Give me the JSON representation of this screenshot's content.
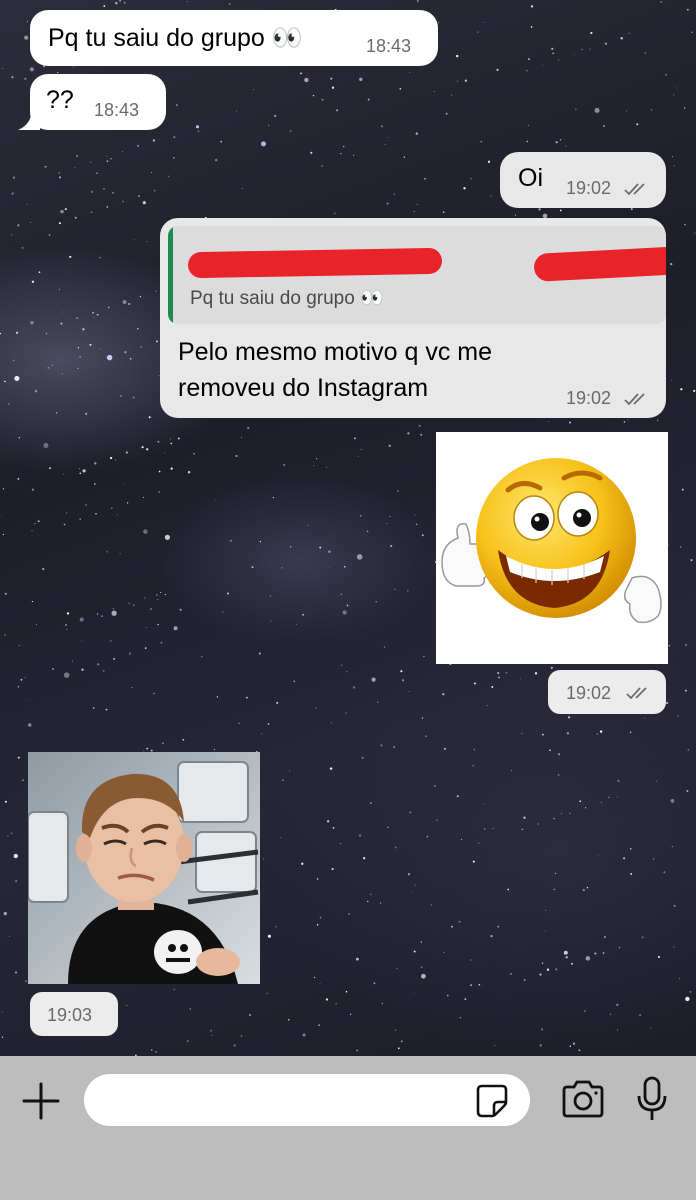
{
  "chat": {
    "messages": [
      {
        "direction": "in",
        "text": "Pq tu saiu do grupo 👀",
        "time": "18:43"
      },
      {
        "direction": "in",
        "text": "??",
        "time": "18:43"
      },
      {
        "direction": "out",
        "text": "Oi",
        "time": "19:02",
        "status": "read"
      },
      {
        "direction": "out",
        "reply_to": "Pq tu saiu do grupo 👀",
        "text_lines": [
          "Pelo mesmo motivo q vc me",
          "removeu do Instagram"
        ],
        "time": "19:02",
        "status": "read"
      },
      {
        "direction": "out",
        "type": "sticker",
        "sticker": "smiling-thumbs-up-emoji-sticker",
        "time": "19:02",
        "status": "read"
      },
      {
        "direction": "in",
        "type": "sticker",
        "sticker": "squinting-boy-photo-sticker",
        "time": "19:03"
      }
    ]
  },
  "composer": {
    "placeholder": "",
    "icons": [
      "plus-icon",
      "sticker-icon",
      "camera-icon",
      "microphone-icon"
    ]
  },
  "colors": {
    "incoming_bubble": "#ffffff",
    "outgoing_bubble": "#e8e8e8",
    "reply_accent": "#1f8a4c",
    "redaction": "#e8232a",
    "input_bar": "#bdbdbd"
  }
}
